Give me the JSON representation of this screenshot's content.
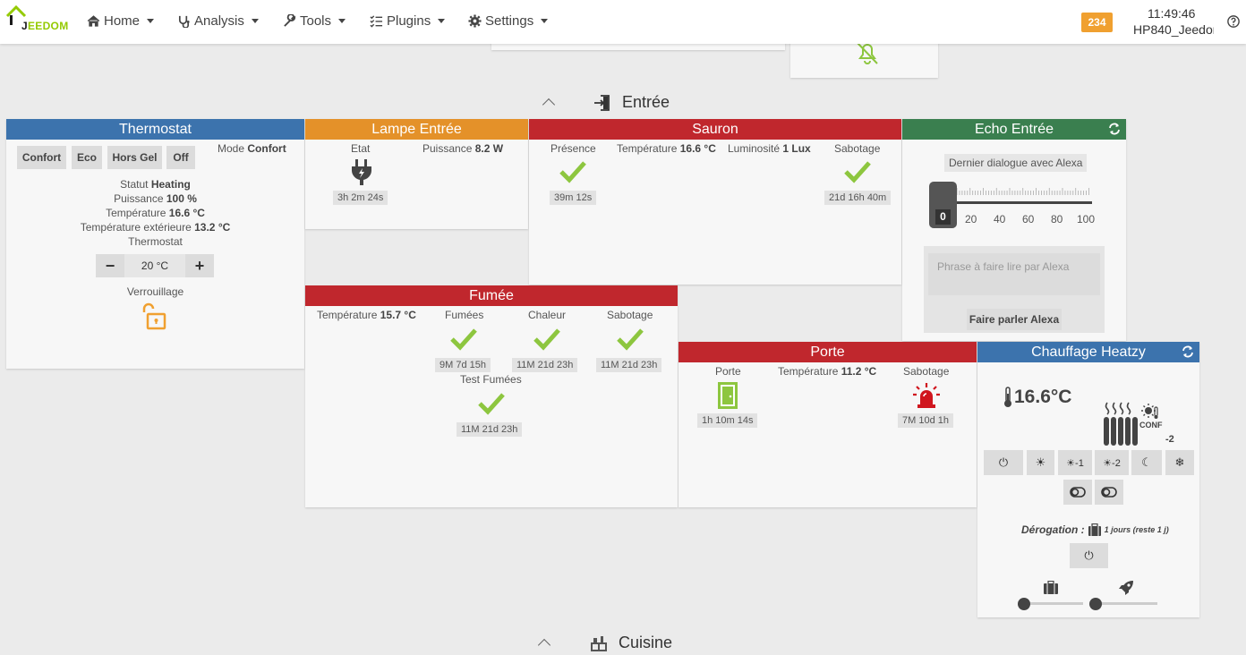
{
  "nav": {
    "logo_text_prefix": "J",
    "logo_text_main": "EEDOM",
    "home": "Home",
    "analysis": "Analysis",
    "tools": "Tools",
    "plugins": "Plugins",
    "settings": "Settings",
    "message_count": "234",
    "time": "11:49:46",
    "host": "HP840_Jeedom"
  },
  "sections": {
    "entree": "Entrée",
    "cuisine": "Cuisine"
  },
  "thermostat": {
    "title": "Thermostat",
    "modes": [
      "Confort",
      "Eco",
      "Hors Gel",
      "Off"
    ],
    "mode_label": "Mode",
    "mode_value": "Confort",
    "statut_label": "Statut",
    "statut_value": "Heating",
    "puissance_label": "Puissance",
    "puissance_value": "100 %",
    "temp_label": "Température",
    "temp_value": "16.6 °C",
    "temp_ext_label": "Température extérieure",
    "temp_ext_value": "13.2 °C",
    "consigne_label": "Thermostat",
    "consigne_value": "20 °C",
    "minus": "−",
    "plus": "+",
    "lock_label": "Verrouillage"
  },
  "lampe": {
    "title": "Lampe Entrée",
    "etat_label": "Etat",
    "etat_time": "3h 2m 24s",
    "puissance_label": "Puissance",
    "puissance_value": "8.2 W"
  },
  "sauron": {
    "title": "Sauron",
    "presence_label": "Présence",
    "presence_time": "39m 12s",
    "temp_label": "Température",
    "temp_value": "16.6 °C",
    "lum_label": "Luminosité",
    "lum_value": "1 Lux",
    "sabotage_label": "Sabotage",
    "sabotage_time": "21d 16h 40m"
  },
  "echo": {
    "title": "Echo Entrée",
    "last_dialog_label": "Dernier dialogue avec Alexa",
    "volume": 0,
    "volume_display": "0",
    "ticks": [
      "20",
      "40",
      "60",
      "80",
      "100"
    ],
    "input_placeholder": "Phrase à faire lire par Alexa",
    "speak_button": "Faire parler Alexa"
  },
  "fumee": {
    "title": "Fumée",
    "temp_label": "Température",
    "temp_value": "15.7 °C",
    "fumees_label": "Fumées",
    "fumees_time": "9M 7d 15h",
    "chaleur_label": "Chaleur",
    "chaleur_time": "11M 21d 23h",
    "sabotage_label": "Sabotage",
    "sabotage_time": "11M 21d 23h",
    "test_label": "Test Fumées",
    "test_time": "11M 21d 23h"
  },
  "porte": {
    "title": "Porte",
    "porte_label": "Porte",
    "porte_time": "1h 10m 14s",
    "temp_label": "Température",
    "temp_value": "11.2 °C",
    "sabotage_label": "Sabotage",
    "sabotage_time": "7M 10d 1h"
  },
  "heatzy": {
    "title": "Chauffage Heatzy",
    "temperature": "16.6°C",
    "mode_tag": "CONF",
    "offset": "-2",
    "buttons": [
      "⏻",
      "☀",
      "☀-1",
      "☀-2",
      "☾",
      "❄"
    ],
    "derog_label": "Dérogation :",
    "derog_value": "1 jours (reste 1 j)",
    "power_button": "⏻",
    "slider_left": 0,
    "slider_right": 0
  },
  "colors": {
    "blue": "#3c73ad",
    "orange": "#e49129",
    "red": "#c0272d",
    "green": "#3a7f4f",
    "check_green": "#8dc63f",
    "alarm_red": "#d0161e",
    "lock_orange": "#f0a030"
  }
}
